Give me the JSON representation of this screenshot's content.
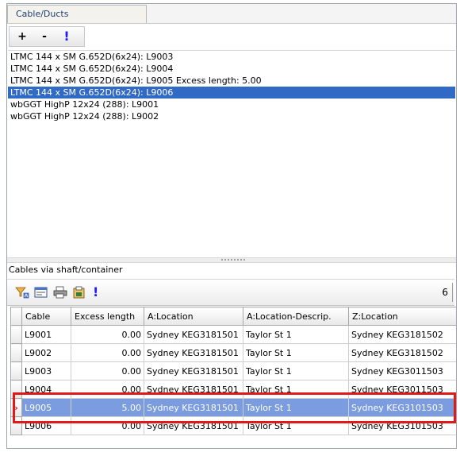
{
  "panel": {
    "tab_label": "Cable/Ducts"
  },
  "toolbar": {
    "add_label": "+",
    "remove_label": "-",
    "alert_label": "!"
  },
  "cable_list": [
    "LTMC 144 x SM G.652D(6x24): L9003",
    "LTMC 144 x SM G.652D(6x24): L9004",
    "LTMC 144 x SM G.652D(6x24): L9005 Excess length: 5.00",
    "LTMC 144 x SM G.652D(6x24): L9006",
    "wbGGT HighP 12x24 (288): L9001",
    "wbGGT HighP 12x24 (288): L9002"
  ],
  "selected_cable_index": 3,
  "shaft_section": {
    "label": "Cables via shaft/container",
    "count": "6",
    "icons": [
      "filter-icon",
      "layout-icon",
      "print-icon",
      "export-icon",
      "alert-icon"
    ],
    "alert_label": "!"
  },
  "grid": {
    "columns": [
      "Cable",
      "Excess length",
      "A:Location",
      "A:Location-Descrip.",
      "Z:Location"
    ],
    "rows": [
      [
        "L9001",
        "0.00",
        "Sydney KEG3181501",
        "Taylor St 1",
        "Sydney KEG3181502"
      ],
      [
        "L9002",
        "0.00",
        "Sydney KEG3181501",
        "Taylor St 1",
        "Sydney KEG3181502"
      ],
      [
        "L9003",
        "0.00",
        "Sydney KEG3181501",
        "Taylor St 1",
        "Sydney KEG3011503"
      ],
      [
        "L9004",
        "0.00",
        "Sydney KEG3181501",
        "Taylor St 1",
        "Sydney KEG3011503"
      ],
      [
        "L9005",
        "5.00",
        "Sydney KEG3181501",
        "Taylor St 1",
        "Sydney KEG3101503"
      ],
      [
        "L9006",
        "0.00",
        "Sydney KEG3181501",
        "Taylor St 1",
        "Sydney KEG3101503"
      ]
    ],
    "selected_row_index": 4,
    "row_indicator": "›"
  },
  "colors": {
    "selection": "#316ac5",
    "grid_selection": "#7b9cde",
    "highlight_box": "#e01919",
    "tab_text": "#1e3c78"
  }
}
